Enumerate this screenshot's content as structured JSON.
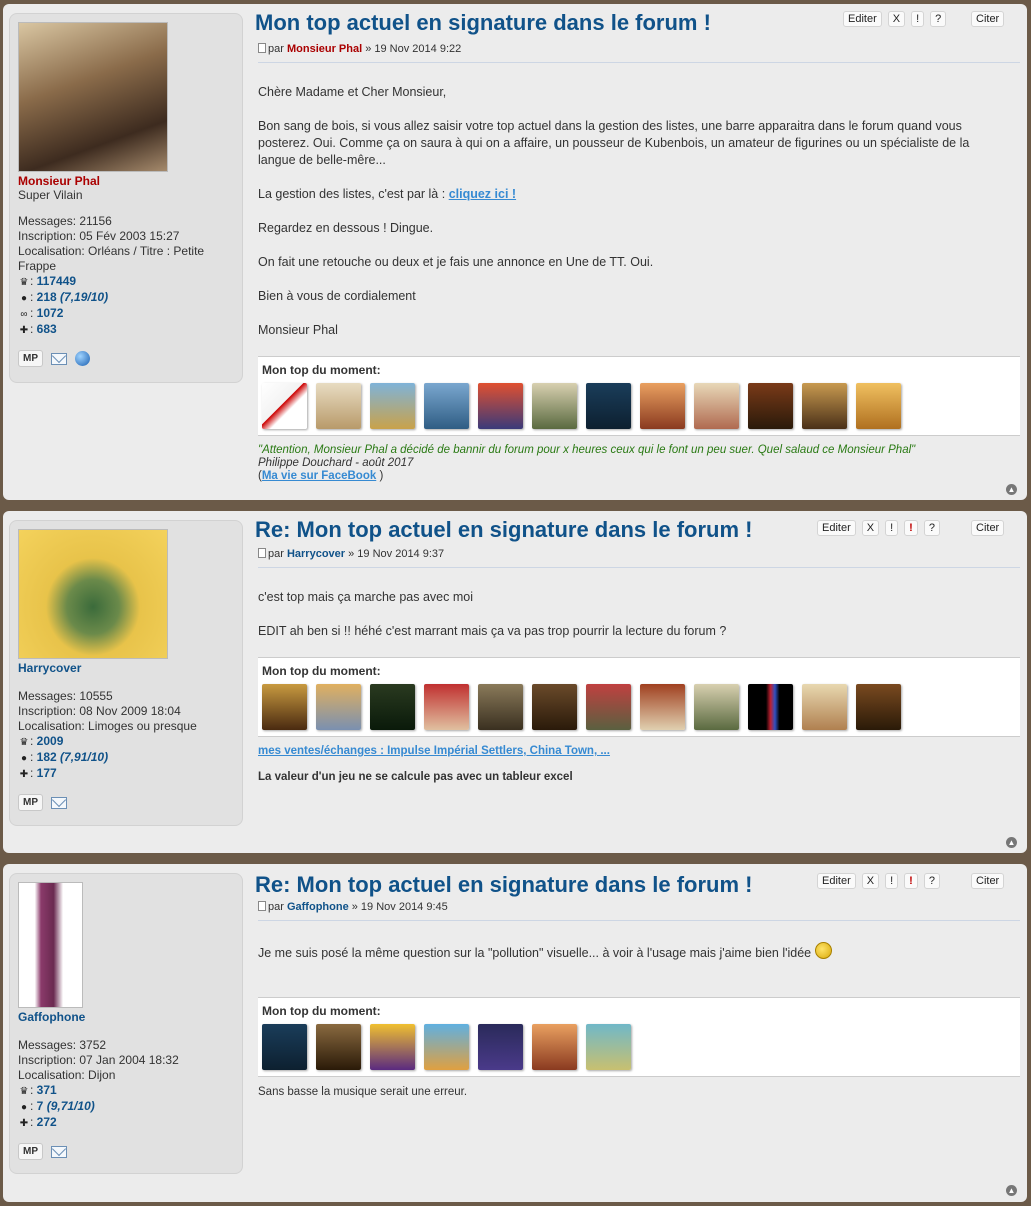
{
  "posts": [
    {
      "author": "Monsieur Phal",
      "rank": "Super Vilain",
      "messages": "Messages: 21156",
      "inscription": "Inscription: 05 Fév 2003 15:27",
      "localisation": "Localisation: Orléans / Titre : Petite Frappe",
      "stat_trophy": "117449",
      "stat_chat": "218",
      "stat_chat_note": "(7,19/10)",
      "stat_mask": "1072",
      "stat_puzzle": "683",
      "mp_label": "MP",
      "title": "Mon top actuel en signature dans le forum !",
      "by": "par",
      "date": "» 19 Nov 2014 9:22",
      "actions": [
        "Editer",
        "X",
        "!",
        "?"
      ],
      "quote_label": "Citer",
      "body": {
        "p1": "Chère Madame et Cher Monsieur,",
        "p2": "Bon sang de bois, si vous allez saisir votre top actuel dans la gestion des listes, une barre apparaitra dans le forum quand vous posterez. Oui. Comme ça on saura à qui on a affaire, un pousseur de Kubenbois, un amateur de figurines ou un spécialiste de la langue de belle-mêre...",
        "p3_pre": "La gestion des listes, c'est par là : ",
        "p3_link": "cliquez ici !",
        "p4": "Regardez en dessous ! Dingue.",
        "p5": "On fait une retouche ou deux et je fais une annonce en Une de TT. Oui.",
        "p6": "Bien à vous de cordialement",
        "p7": "Monsieur Phal"
      },
      "top_label": "Mon top du moment:",
      "sig": {
        "quote": "\"Attention, Monsieur Phal a décidé de bannir du forum pour x heures ceux qui le font un peu suer. Quel salaud ce Monsieur Phal\"",
        "attrib": "Philippe Douchard - août 2017",
        "link_open": "(",
        "link": "Ma vie sur FaceBook",
        "link_close": " )"
      }
    },
    {
      "author": "Harrycover",
      "messages": "Messages: 10555",
      "inscription": "Inscription: 08 Nov 2009 18:04",
      "localisation": "Localisation: Limoges ou presque",
      "stat_trophy": "2009",
      "stat_chat": "182",
      "stat_chat_note": "(7,91/10)",
      "stat_puzzle": "177",
      "mp_label": "MP",
      "title": "Re: Mon top actuel en signature dans le forum !",
      "by": "par",
      "date": "» 19 Nov 2014 9:37",
      "actions": [
        "Editer",
        "X",
        "!",
        "!",
        "?"
      ],
      "quote_label": "Citer",
      "body": {
        "p1": "c'est top mais ça marche pas avec moi",
        "p2": "EDIT ah ben si !! héhé c'est marrant mais ça va pas trop pourrir la lecture du forum ?"
      },
      "top_label": "Mon top du moment:",
      "sig": {
        "link": "mes ventes/échanges : Impulse Impérial Settlers, China Town, ...",
        "bold": "La valeur d'un jeu ne se calcule pas avec un tableur excel"
      }
    },
    {
      "author": "Gaffophone",
      "messages": "Messages: 3752",
      "inscription": "Inscription: 07 Jan 2004 18:32",
      "localisation": "Localisation: Dijon",
      "stat_trophy": "371",
      "stat_chat": "7",
      "stat_chat_note": "(9,71/10)",
      "stat_puzzle": "272",
      "mp_label": "MP",
      "title": "Re: Mon top actuel en signature dans le forum !",
      "by": "par",
      "date": "» 19 Nov 2014 9:45",
      "actions": [
        "Editer",
        "X",
        "!",
        "!",
        "?"
      ],
      "quote_label": "Citer",
      "body": {
        "p1": "Je me suis posé la même question sur la \"pollution\" visuelle... à voir à l'usage mais j'aime bien l'idée"
      },
      "top_label": "Mon top du moment:",
      "sig": {
        "plain": "Sans basse la musique serait une erreur."
      }
    }
  ],
  "colors": {
    "title_blue": "#105289",
    "admin_red": "#aa0000",
    "quote_green": "#2a7a14",
    "link_blue": "#368ad2"
  },
  "icons": [
    "trophy-icon",
    "chat-icon",
    "mask-icon",
    "puzzle-icon",
    "mail-icon",
    "globe-icon",
    "top-icon",
    "document-icon",
    "smiley-icon"
  ]
}
